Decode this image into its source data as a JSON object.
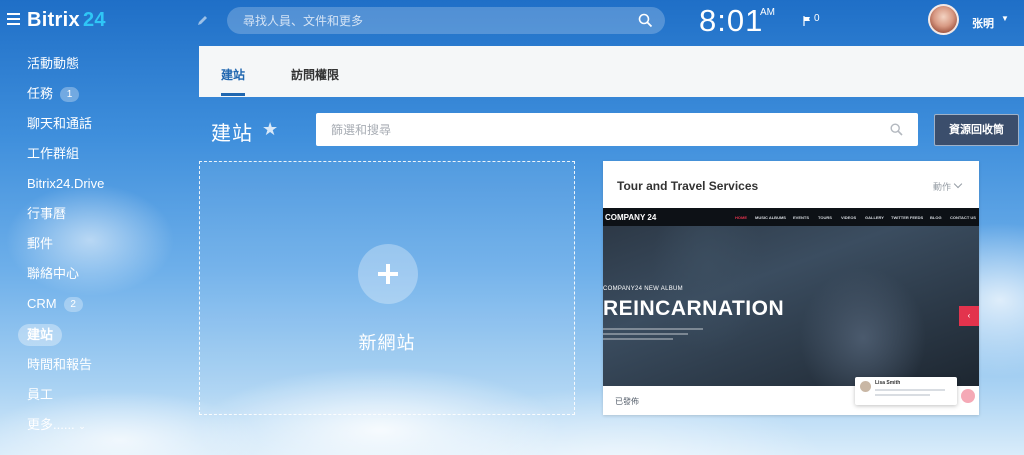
{
  "header": {
    "logo_part1": "Bitrix",
    "logo_part2": "24",
    "search_placeholder": "尋找人員、文件和更多",
    "time": "8:01",
    "ampm": "AM",
    "notification_count": "0",
    "user_name": "张明"
  },
  "sidebar": {
    "items": [
      {
        "label": "活動動態"
      },
      {
        "label": "任務",
        "count": "1"
      },
      {
        "label": "聊天和通話"
      },
      {
        "label": "工作群組"
      },
      {
        "label": "Bitrix24.Drive"
      },
      {
        "label": "行事曆"
      },
      {
        "label": "郵件"
      },
      {
        "label": "聯絡中心"
      },
      {
        "label": "CRM",
        "count": "2"
      },
      {
        "label": "建站",
        "active": true
      },
      {
        "label": "時間和報告"
      },
      {
        "label": "員工"
      },
      {
        "label": "更多......"
      }
    ]
  },
  "tabs": [
    {
      "label": "建站",
      "active": true
    },
    {
      "label": "訪問權限"
    }
  ],
  "page": {
    "title": "建站",
    "filter_placeholder": "篩選和搜尋",
    "recycle_button": "資源回收筒"
  },
  "add_tile": {
    "label": "新網站"
  },
  "site_card": {
    "title": "Tour and Travel Services",
    "actions_label": "動作",
    "status": "已發佈",
    "preview": {
      "brand": "COMPANY 24",
      "menu": [
        "HOME",
        "MUSIC ALBUMS",
        "EVENTS",
        "TOURS",
        "VIDEOS",
        "GALLERY",
        "TWITTER FEEDS",
        "BLOG",
        "CONTACT US"
      ],
      "album_label": "COMPANY24 NEW ALBUM",
      "headline": "REINCARNATION",
      "popup_name": "Lisa Smith"
    }
  },
  "colors": {
    "accent": "#2fc6f6",
    "tab_active": "#2067b0",
    "recycle_button_bg": "#3b4e6c",
    "preview_accent": "#e3334d"
  }
}
